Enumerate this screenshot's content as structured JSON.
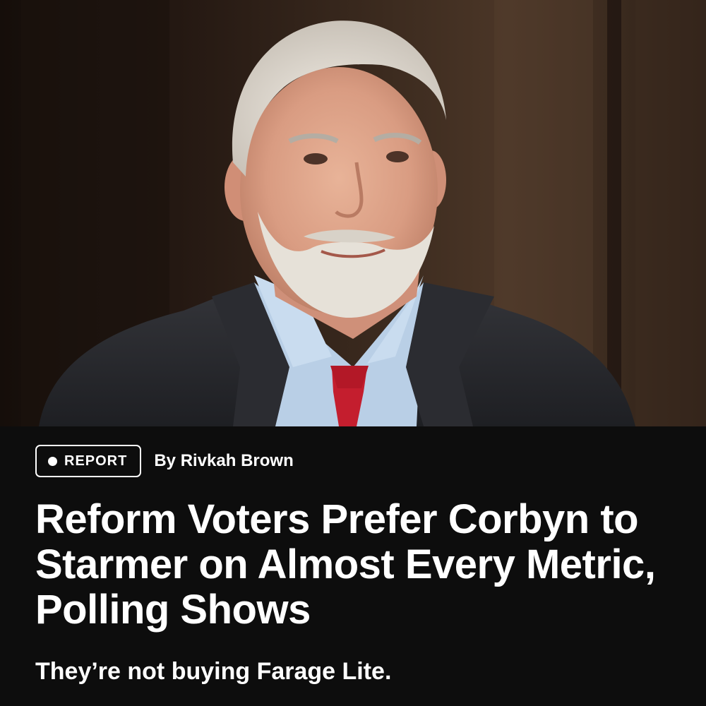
{
  "article": {
    "badge": {
      "label": "REPORT",
      "icon": "dot-icon"
    },
    "byline": "By Rivkah Brown",
    "headline": "Reform Voters Prefer Corbyn to Starmer on Almost Every Metric, Polling Shows",
    "subhead": "They’re not buying Farage Lite."
  },
  "colors": {
    "panel_background": "#0d0d0d",
    "text": "#ffffff",
    "tie": "#c41e2e",
    "shirt": "#b9cfe6",
    "suit": "#26272b"
  }
}
